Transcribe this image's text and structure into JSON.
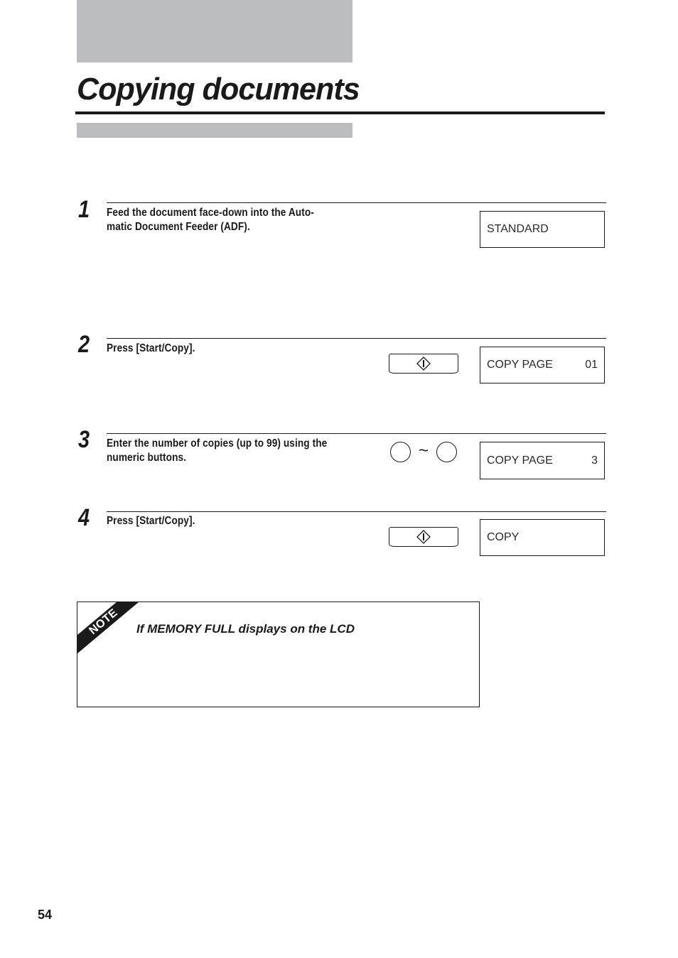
{
  "page": {
    "title": "Copying documents",
    "page_number": "54"
  },
  "steps": [
    {
      "number": "1",
      "instruction": "Feed the document face-down into the Automatic Document Feeder (ADF).",
      "instruction_lines": [
        "Feed the document face-down into the Auto-",
        "matic Document Feeder (ADF)."
      ],
      "control": null,
      "lcd": {
        "left": "STANDARD",
        "right": ""
      }
    },
    {
      "number": "2",
      "instruction": "Press [Start/Copy].",
      "instruction_lines": [
        "Press [Start/Copy]."
      ],
      "control": "start-copy-button",
      "lcd": {
        "left": "COPY PAGE",
        "right": "01"
      }
    },
    {
      "number": "3",
      "instruction": "Enter the number of copies (up to 99) using the numeric buttons.",
      "instruction_lines": [
        "Enter the number of copies (up to 99) using the",
        "numeric buttons."
      ],
      "control": "numeric-buttons",
      "control_separator": "~",
      "lcd": {
        "left": "COPY PAGE",
        "right": "3"
      }
    },
    {
      "number": "4",
      "instruction": "Press [Start/Copy].",
      "instruction_lines": [
        "Press [Start/Copy]."
      ],
      "control": "start-copy-button",
      "lcd": {
        "left": "COPY",
        "right": ""
      }
    }
  ],
  "note": {
    "label": "NOTE",
    "title": "If MEMORY FULL displays on the LCD"
  },
  "colors": {
    "gray_band": "#bbbcc0",
    "ink": "#1a1a1a"
  }
}
